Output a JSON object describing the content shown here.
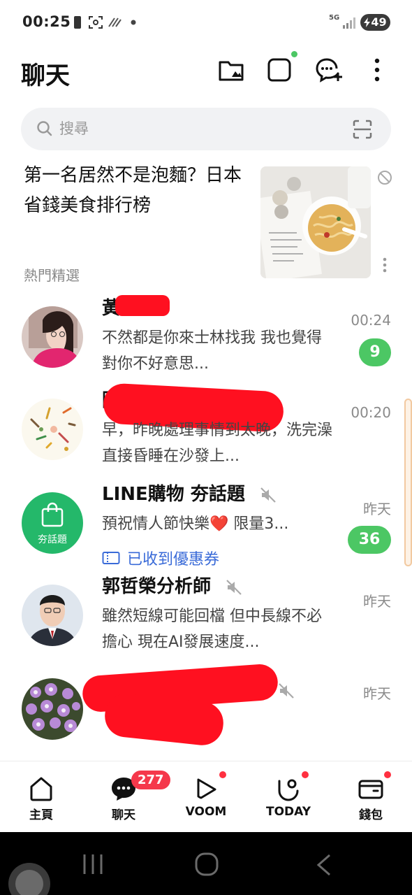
{
  "status_bar": {
    "time": "00:25",
    "network": "5G",
    "battery": "49"
  },
  "header": {
    "title": "聊天",
    "icons": [
      "folder-icon",
      "square-chat-icon",
      "add-chat-icon",
      "more-vertical-icon"
    ]
  },
  "search": {
    "placeholder": "搜尋"
  },
  "promo": {
    "headline": "第一名居然不是泡麵？日本省錢美食排行榜",
    "label": "熱門精選"
  },
  "chats": [
    {
      "name": "黃",
      "message": "不然都是你來士林找我 我也覺得對你不好意思...",
      "time": "00:24",
      "unread": "9"
    },
    {
      "name": "陳",
      "message": "早，昨晚處理事情到太晚，洗完澡直接昏睡在沙發上...",
      "time": "00:20"
    },
    {
      "name": "LINE購物 夯話題",
      "avatar_text": "夯話題",
      "message": "預祝情人節快樂❤️ 限量3...",
      "coupon": "已收到優惠券",
      "time": "昨天",
      "unread": "36"
    },
    {
      "name": "郭哲榮分析師",
      "message": "雖然短線可能回檔 但中長線不必擔心 現在AI發展速度...",
      "time": "昨天"
    },
    {
      "name": "",
      "message": "",
      "time": "昨天"
    }
  ],
  "bottom_nav": {
    "items": [
      {
        "label": "主頁",
        "icon": "home-icon"
      },
      {
        "label": "聊天",
        "icon": "chat-icon",
        "badge": "277"
      },
      {
        "label": "VOOM",
        "icon": "voom-icon"
      },
      {
        "label": "TODAY",
        "icon": "today-icon"
      },
      {
        "label": "錢包",
        "icon": "wallet-icon"
      }
    ]
  },
  "colors": {
    "line_green": "#4cc764",
    "badge_red": "#f5384b",
    "link_blue": "#3a6bd8"
  }
}
